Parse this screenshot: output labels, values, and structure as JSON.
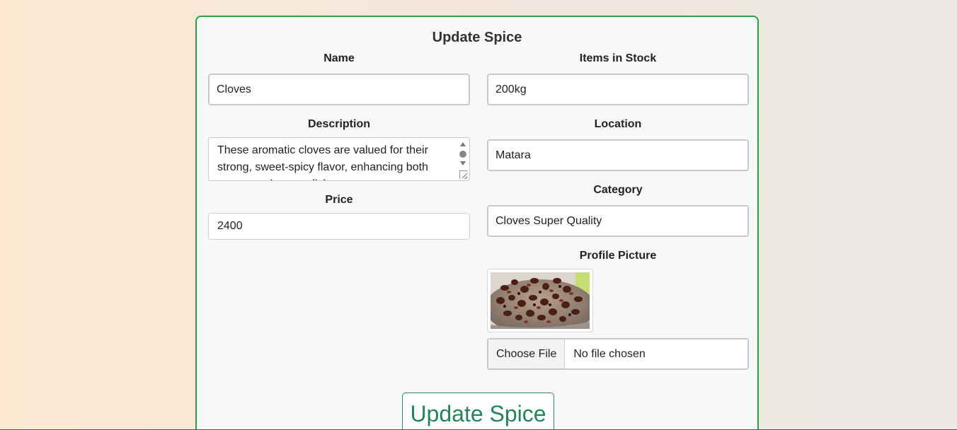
{
  "form": {
    "title": "Update Spice",
    "name_label": "Name",
    "name_value": "Cloves",
    "stock_label": "Items in Stock",
    "stock_value": "200kg",
    "description_label": "Description",
    "description_value": "These aromatic cloves are valued for their strong, sweet-spicy flavor, enhancing both savory and sweet dishes.",
    "location_label": "Location",
    "location_value": "Matara",
    "price_label": "Price",
    "price_value": "2400",
    "category_label": "Category",
    "category_value": "Cloves Super Quality",
    "picture_label": "Profile Picture",
    "choose_file_label": "Choose File",
    "file_status": "No file chosen",
    "submit_label": "Update Spice"
  },
  "colors": {
    "card_border": "#2f9e44",
    "button_text": "#23855a"
  }
}
